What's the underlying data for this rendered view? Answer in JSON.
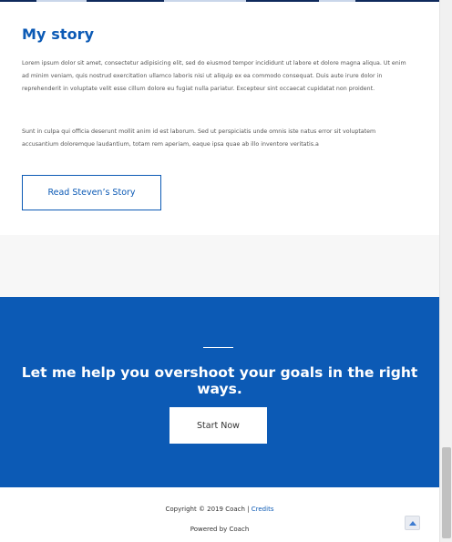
{
  "story": {
    "title": "My story",
    "paragraph_1": "Lorem ipsum dolor sit amet, consectetur adipisicing elit, sed do eiusmod tempor incididunt ut labore et dolore magna aliqua. Ut enim ad minim veniam, quis nostrud exercitation ullamco laboris nisi ut aliquip ex ea commodo consequat. Duis aute irure dolor in reprehenderit in voluptate velit esse cillum dolore eu fugiat nulla pariatur. Excepteur sint occaecat cupidatat non proident.",
    "paragraph_2": "Sunt in culpa qui officia deserunt mollit anim id est laborum. Sed ut perspiciatis unde omnis iste natus error sit voluptatem accusantium doloremque laudantium, totam rem aperiam, eaque ipsa quae ab illo inventore veritatis.a",
    "button_label": "Read Steven’s Story"
  },
  "cta": {
    "heading": "Let me help you overshoot your goals in the right ways.",
    "button_label": "Start Now"
  },
  "footer": {
    "copyright": "Copyright © 2019 Coach | ",
    "credits_link": "Credits",
    "powered_by": "Powered by Coach"
  },
  "icons": {
    "scroll_top": "arrow-up-icon"
  },
  "colors": {
    "accent": "#0c5ab5",
    "cta_background": "#0c5ab5",
    "page_background": "#ffffff",
    "band_background": "#f7f7f7"
  }
}
